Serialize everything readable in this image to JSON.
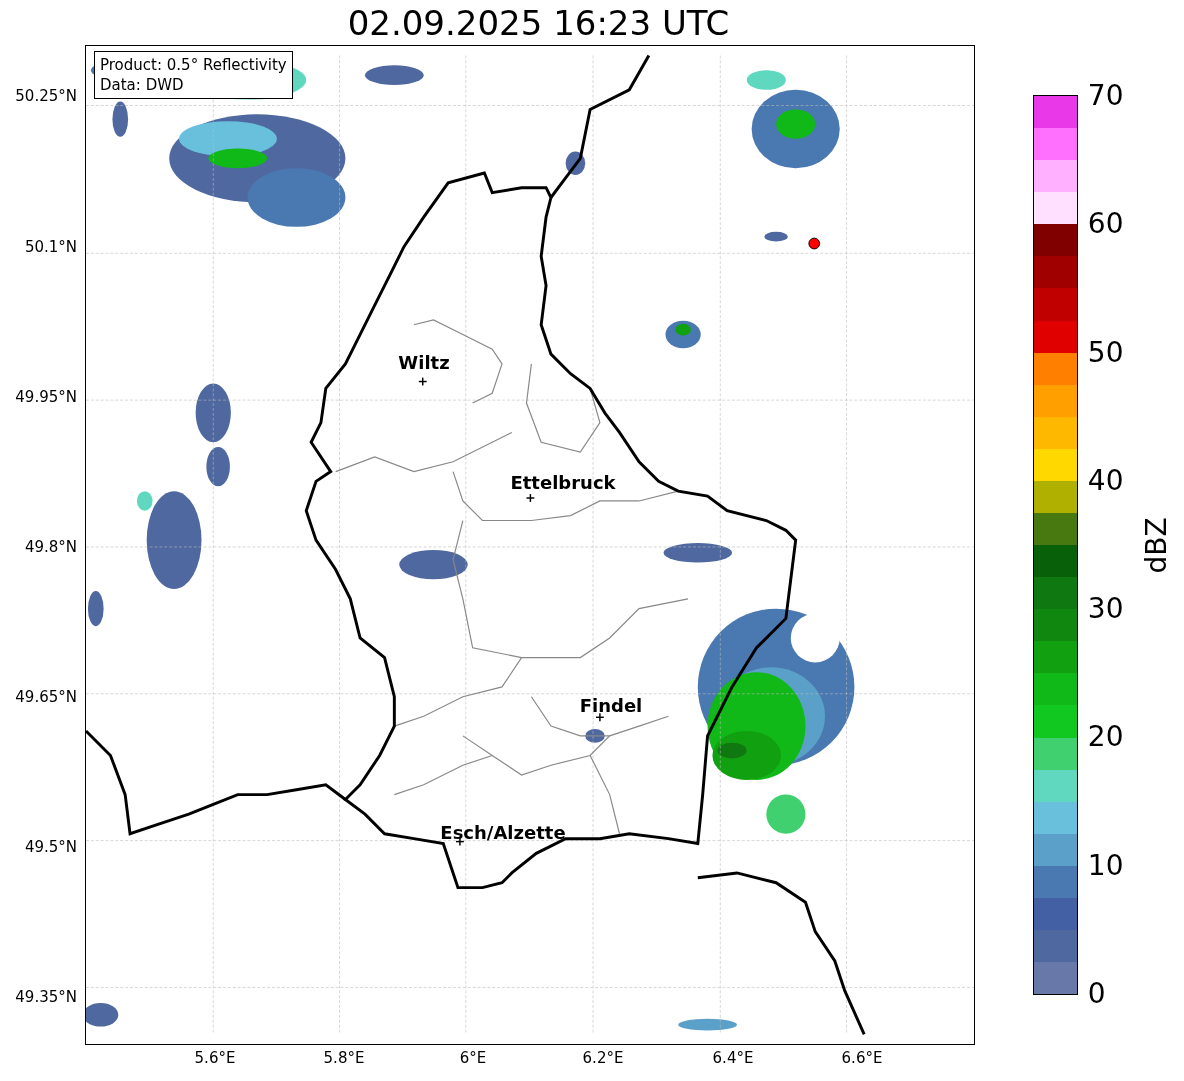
{
  "title": "02.09.2025 16:23 UTC",
  "info_box": [
    "Product: 0.5° Reflectivity",
    "Data: DWD"
  ],
  "lat_ticks": [
    "50.25°N",
    "50.1°N",
    "49.95°N",
    "49.8°N",
    "49.65°N",
    "49.5°N",
    "49.35°N"
  ],
  "lon_ticks": [
    "5.6°E",
    "5.8°E",
    "6°E",
    "6.2°E",
    "6.4°E",
    "6.6°E"
  ],
  "cities": [
    {
      "name": "Wiltz"
    },
    {
      "name": "Ettelbruck"
    },
    {
      "name": "Findel"
    },
    {
      "name": "Esch/Alzette"
    }
  ],
  "colorbar": {
    "label": "dBZ",
    "ticks": [
      "70",
      "60",
      "50",
      "40",
      "30",
      "20",
      "10",
      "0"
    ],
    "segments": [
      {
        "color": "#e838e8"
      },
      {
        "color": "#ff70ff"
      },
      {
        "color": "#ffb0ff"
      },
      {
        "color": "#ffe0ff"
      },
      {
        "color": "#800000"
      },
      {
        "color": "#a00000"
      },
      {
        "color": "#c00000"
      },
      {
        "color": "#e00000"
      },
      {
        "color": "#ff8000"
      },
      {
        "color": "#ffa000"
      },
      {
        "color": "#ffb800"
      },
      {
        "color": "#ffd800"
      },
      {
        "color": "#b0b000"
      },
      {
        "color": "#487810"
      },
      {
        "color": "#086008"
      },
      {
        "color": "#107810"
      },
      {
        "color": "#108810"
      },
      {
        "color": "#10a010"
      },
      {
        "color": "#10b818"
      },
      {
        "color": "#10c820"
      },
      {
        "color": "#40d070"
      },
      {
        "color": "#60d8c0"
      },
      {
        "color": "#68c0dc"
      },
      {
        "color": "#5aa0c8"
      },
      {
        "color": "#4a78b0"
      },
      {
        "color": "#4460a4"
      },
      {
        "color": "#5068a0"
      },
      {
        "color": "#6878a8"
      }
    ]
  }
}
